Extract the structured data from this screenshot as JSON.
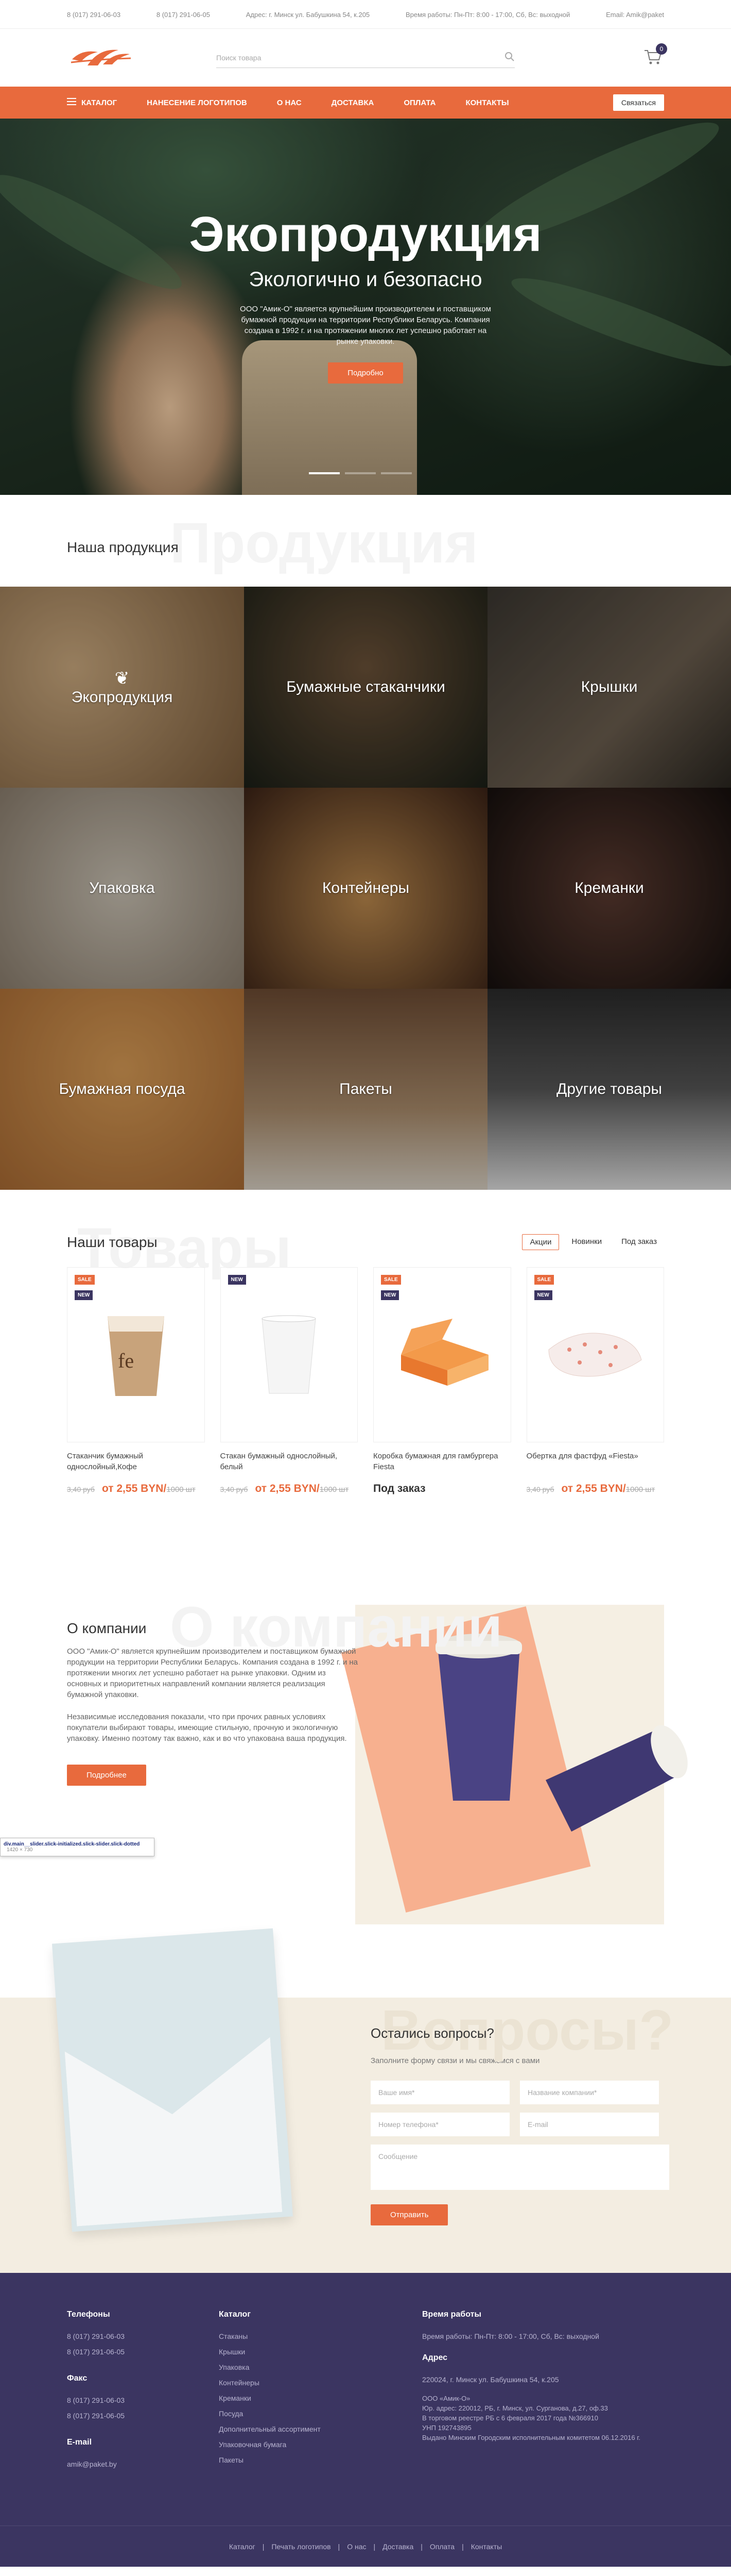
{
  "topbar": {
    "phone1": "8 (017) 291-06-03",
    "phone2": "8 (017) 291-06-05",
    "address": "Адрес: г. Минск ул. Бабушкина 54, к.205",
    "hours": "Время работы: Пн-Пт: 8:00 - 17:00, Сб, Вс: выходной",
    "email": "Email: Amik@paket"
  },
  "header": {
    "search_placeholder": "Поиск товара",
    "cart_count": "0"
  },
  "nav": {
    "catalog": "Каталог",
    "items": [
      "Нанесение логотипов",
      "О нас",
      "Доставка",
      "Оплата",
      "Контакты"
    ],
    "contact_button": "Связаться"
  },
  "hero": {
    "title": "Экопродукция",
    "subtitle": "Экологично и безопасно",
    "text": "ООО \"Амик-О\" является крупнейшим производителем и поставщиком бумажной продукции на территории Республики Беларусь. Компания создана в 1992 г. и на протяжении многих лет успешно работает на рынке упаковки.",
    "button": "Подробно"
  },
  "products_section": {
    "bg_title": "Продукция",
    "title": "Наша продукция",
    "categories": [
      "Экопродукция",
      "Бумажные стаканчики",
      "Крышки",
      "Упаковка",
      "Контейнеры",
      "Креманки",
      "Бумажная посуда",
      "Пакеты",
      "Другие товары"
    ]
  },
  "goods_section": {
    "bg_title": "Товары",
    "title": "Наши товары",
    "tabs": [
      "Акции",
      "Новинки",
      "Под заказ"
    ],
    "badge_sale": "SALE",
    "badge_new": "NEW",
    "cards": [
      {
        "name": "Стаканчик бумажный однослойный,Кофе",
        "old_price": "3,40 руб",
        "price": "от 2,55 BYN/",
        "unit": "1000 шт"
      },
      {
        "name": "Стакан бумажный однослойный, белый",
        "old_price": "3,40 руб",
        "price": "от 2,55 BYN/",
        "unit": "1000 шт"
      },
      {
        "name": "Коробка бумажная для гамбургера Fiesta",
        "old_price": "",
        "price": "Под заказ",
        "unit": ""
      },
      {
        "name": "Обертка для фастфуд «Fiesta»",
        "old_price": "3,40 руб",
        "price": "от 2,55 BYN/",
        "unit": "1000 шт"
      }
    ]
  },
  "about": {
    "bg_title": "О компании",
    "title": "О компании",
    "p1": "ООО \"Амик-О\" является крупнейшим производителем и поставщиком бумажной продукции на территории Республики Беларусь. Компания создана в 1992 г. и на протяжении многих лет успешно работает на рынке упаковки. Одним из основных и приоритетных направлений компании является реализация бумажной упаковки.",
    "p2": "Независимые исследования показали, что при прочих равных условиях покупатели выбирают товары, имеющие стильную, прочную и экологичную упаковку. Именно поэтому так важно, как и во что упакована ваша продукция.",
    "button": "Подробнее"
  },
  "tooltip": {
    "selector": "div.main__slider.slick-initialized.slick-slider.slick-dotted",
    "size": "1420 × 730"
  },
  "questions": {
    "bg_title": "Вопросы?",
    "title": "Остались вопросы?",
    "subtitle": "Заполните форму связи и мы свяжемся с вами",
    "name_ph": "Ваше имя*",
    "company_ph": "Название компании*",
    "phone_ph": "Номер телефона*",
    "email_ph": "E-mail",
    "message_ph": "Сообщение",
    "button": "Отправить"
  },
  "footer": {
    "phones_h": "Телефоны",
    "phones": [
      "8 (017) 291-06-03",
      "8 (017) 291-06-05"
    ],
    "fax_h": "Факс",
    "fax": [
      "8 (017) 291-06-03",
      "8 (017) 291-06-05"
    ],
    "email_h": "E-mail",
    "email": "amik@paket.by",
    "catalog_h": "Каталог",
    "catalog": [
      "Стаканы",
      "Крышки",
      "Упаковка",
      "Контейнеры",
      "Креманки",
      "Посуда",
      "Дополнительный ассортимент",
      "Упаковочная бумага",
      "Пакеты"
    ],
    "hours_h": "Время работы",
    "hours": "Время работы: Пн-Пт: 8:00 - 17:00, Сб, Вс: выходной",
    "address_h": "Адрес",
    "address": "220024, г. Минск ул. Бабушкина 54, к.205",
    "legal": [
      "ООО «Амик-О»",
      "Юр. адрес: 220012, РБ, г. Минск, ул. Сурганова, д.27, оф.33",
      "В торговом реестре РБ с 6 февраля 2017 года №366910",
      "УНП 192743895",
      "Выдано Минским Городским исполнительным комитетом 06.12.2016 г."
    ],
    "bottom_links": [
      "Каталог",
      "Печать логотипов",
      "О нас",
      "Доставка",
      "Оплата",
      "Контакты"
    ]
  },
  "colors": {
    "accent": "#e86a3d",
    "dark": "#3b3561",
    "cream": "#f3ede1"
  }
}
